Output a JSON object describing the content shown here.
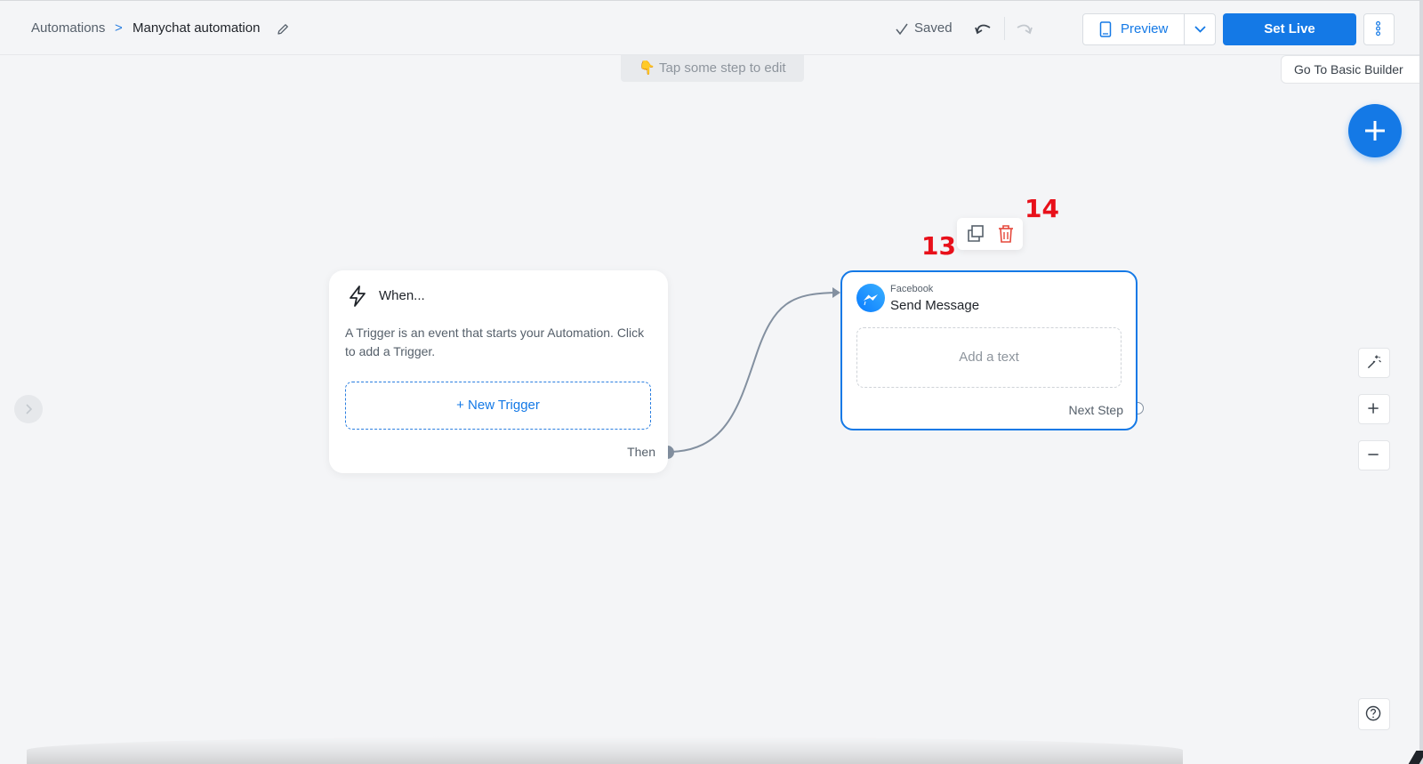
{
  "header": {
    "breadcrumb_root": "Automations",
    "breadcrumb_separator": ">",
    "breadcrumb_current": "Manychat automation",
    "saved_label": "Saved",
    "preview_label": "Preview",
    "set_live_label": "Set Live"
  },
  "canvas": {
    "hint": "👇 Tap some step to edit",
    "basic_builder_label": "Go To Basic Builder"
  },
  "trigger_card": {
    "title": "When...",
    "description": "A Trigger is an event that starts your Automation. Click to add a Trigger.",
    "new_trigger_label": "+ New Trigger",
    "then_label": "Then"
  },
  "message_card": {
    "channel": "Facebook",
    "title": "Send Message",
    "add_text_label": "Add a text",
    "next_step_label": "Next Step"
  },
  "annotations": {
    "marker_13": "13",
    "marker_14": "14"
  },
  "icons": {
    "pencil": "pencil-icon",
    "check": "check-icon",
    "undo": "undo-icon",
    "redo": "redo-icon",
    "preview": "phone-icon",
    "caret": "chevron-down-icon",
    "more": "more-vertical-icon",
    "plus": "plus-icon",
    "bolt": "lightning-icon",
    "messenger": "messenger-icon",
    "copy": "copy-icon",
    "delete": "trash-icon",
    "magic": "magic-wand-icon",
    "zoom_in": "plus-icon",
    "zoom_out": "minus-icon",
    "help": "help-icon",
    "side_toggle": "chevron-right-icon"
  },
  "colors": {
    "accent": "#1479e6",
    "canvas_bg": "#f4f5f7",
    "danger": "#e5483c",
    "connector": "#8390a0",
    "marker": "#e8101a"
  }
}
